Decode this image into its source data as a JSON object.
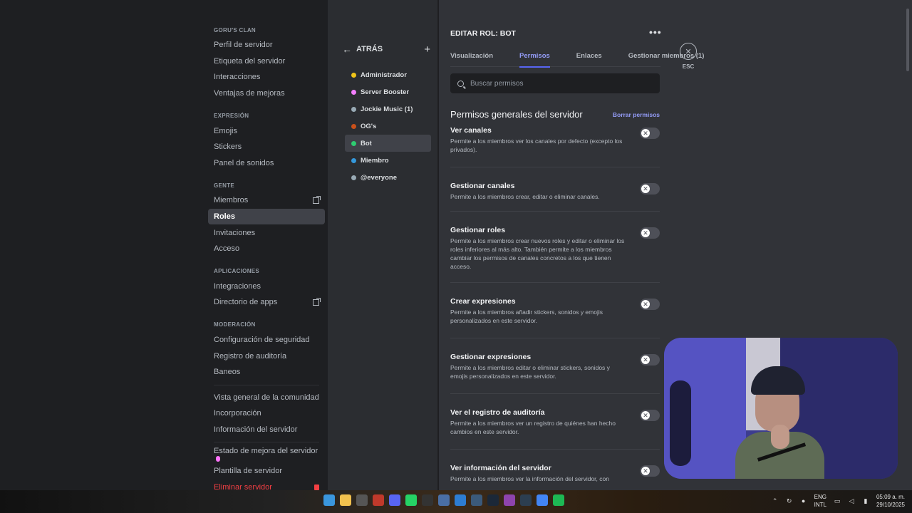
{
  "window_controls": {
    "minimize": "—",
    "maximize": "☐",
    "close": "✕"
  },
  "sidebar": {
    "sections": [
      {
        "header": "GORU'S CLAN",
        "items": [
          {
            "label": "Perfil de servidor"
          },
          {
            "label": "Etiqueta del servidor"
          },
          {
            "label": "Interacciones"
          },
          {
            "label": "Ventajas de mejoras"
          }
        ]
      },
      {
        "header": "EXPRESIÓN",
        "items": [
          {
            "label": "Emojis"
          },
          {
            "label": "Stickers"
          },
          {
            "label": "Panel de sonidos"
          }
        ]
      },
      {
        "header": "GENTE",
        "items": [
          {
            "label": "Miembros",
            "icon": "external-link-icon"
          },
          {
            "label": "Roles",
            "active": true
          },
          {
            "label": "Invitaciones"
          },
          {
            "label": "Acceso"
          }
        ]
      },
      {
        "header": "APLICACIONES",
        "items": [
          {
            "label": "Integraciones"
          },
          {
            "label": "Directorio de apps",
            "icon": "external-link-icon"
          }
        ]
      },
      {
        "header": "MODERACIÓN",
        "items": [
          {
            "label": "Configuración de seguridad"
          },
          {
            "label": "Registro de auditoría"
          },
          {
            "label": "Baneos"
          }
        ]
      }
    ],
    "extra_items": [
      {
        "label": "Vista general de la comunidad"
      },
      {
        "label": "Incorporación"
      },
      {
        "label": "Información del servidor"
      }
    ],
    "bottom_items": [
      {
        "label": "Estado de mejora del servidor"
      },
      {
        "label": "Plantilla de servidor"
      },
      {
        "label": "Eliminar servidor"
      }
    ]
  },
  "roles_panel": {
    "back_label": "ATRÁS",
    "add_symbol": "+",
    "roles": [
      {
        "name": "Administrador",
        "color": "#f0c419"
      },
      {
        "name": "Server Booster",
        "color": "#f47fff"
      },
      {
        "name": "Jockie Music (1)",
        "color": "#99aab5"
      },
      {
        "name": "OG's",
        "color": "#c8501a"
      },
      {
        "name": "Bot",
        "color": "#2ecc71",
        "active": true
      },
      {
        "name": "Miembro",
        "color": "#3498db"
      },
      {
        "name": "@everyone",
        "color": "#99aab5"
      }
    ]
  },
  "main": {
    "title": "EDITAR ROL: BOT",
    "more_symbol": "•••",
    "esc_label": "ESC",
    "close_symbol": "✕",
    "tabs": [
      {
        "label": "Visualización"
      },
      {
        "label": "Permisos",
        "active": true
      },
      {
        "label": "Enlaces"
      },
      {
        "label": "Gestionar miembros (1)"
      }
    ],
    "search": {
      "placeholder": "Buscar permisos"
    },
    "section_title": "Permisos generales del servidor",
    "clear_label": "Borrar permisos",
    "permissions": [
      {
        "name": "Ver canales",
        "desc": "Permite a los miembros ver los canales por defecto (excepto los privados).",
        "enabled": false
      },
      {
        "name": "Gestionar canales",
        "desc": "Permite a los miembros crear, editar o eliminar canales.",
        "enabled": false
      },
      {
        "name": "Gestionar roles",
        "desc": "Permite a los miembros crear nuevos roles y editar o eliminar los roles inferiores al más alto. También permite a los miembros cambiar los permisos de canales concretos a los que tienen acceso.",
        "enabled": false
      },
      {
        "name": "Crear expresiones",
        "desc": "Permite a los miembros añadir stickers, sonidos y emojis personalizados en este servidor.",
        "enabled": false
      },
      {
        "name": "Gestionar expresiones",
        "desc": "Permite a los miembros editar o eliminar stickers, sonidos y emojis personalizados en este servidor.",
        "enabled": false
      },
      {
        "name": "Ver el registro de auditoría",
        "desc": "Permite a los miembros ver un registro de quiénes han hecho cambios en este servidor.",
        "enabled": false
      },
      {
        "name": "Ver información del servidor",
        "desc": "Permite a los miembros ver la información del servidor, con",
        "enabled": false
      }
    ],
    "toggle_symbol": "✕"
  },
  "taskbar": {
    "apps": [
      {
        "name": "windows-start-icon",
        "color": "#3a96dd"
      },
      {
        "name": "file-explorer-icon",
        "color": "#f2c14e"
      },
      {
        "name": "chrome-icon",
        "color": "#555"
      },
      {
        "name": "video-app-icon",
        "color": "#c0392b"
      },
      {
        "name": "discord-icon",
        "color": "#5865f2"
      },
      {
        "name": "whatsapp-icon",
        "color": "#25d366"
      },
      {
        "name": "obs-icon",
        "color": "#333"
      },
      {
        "name": "app-icon",
        "color": "#4a6fa5"
      },
      {
        "name": "app-icon",
        "color": "#2d7dd2"
      },
      {
        "name": "calculator-icon",
        "color": "#3b5a7a"
      },
      {
        "name": "steam-icon",
        "color": "#1b2838"
      },
      {
        "name": "app-icon",
        "color": "#8e44ad"
      },
      {
        "name": "app-icon",
        "color": "#2c3e50"
      },
      {
        "name": "app-icon",
        "color": "#4285f4"
      },
      {
        "name": "spotify-icon",
        "color": "#1db954"
      }
    ],
    "lang_top": "ENG",
    "lang_bottom": "INTL",
    "time": "05:09 a. m.",
    "date": "29/10/2025"
  }
}
